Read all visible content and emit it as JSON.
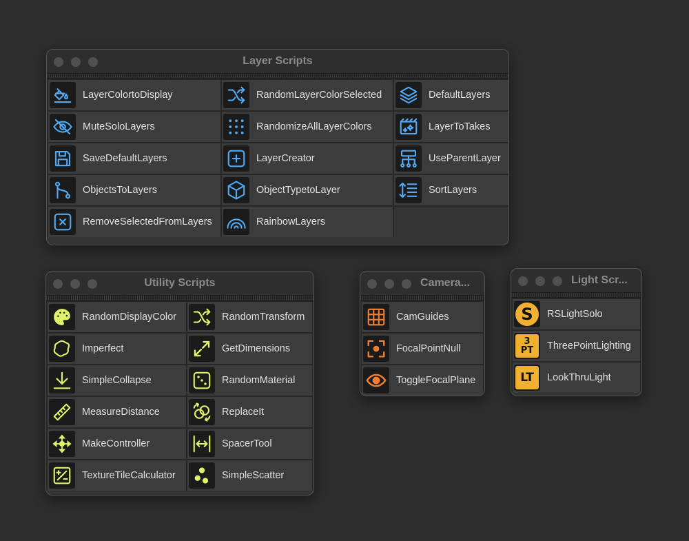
{
  "colors": {
    "background": "#2d2d2d",
    "layer_accent": "#52aaf5",
    "utility_accent": "#dff26a",
    "camera_accent": "#f08030",
    "light_accent": "#f0b030"
  },
  "layer_window": {
    "title": "Layer Scripts",
    "items": [
      {
        "label": "LayerColortoDisplay",
        "icon": "paint-bucket-icon"
      },
      {
        "label": "RandomLayerColorSelected",
        "icon": "shuffle-icon"
      },
      {
        "label": "DefaultLayers",
        "icon": "layers-stack-icon"
      },
      {
        "label": "MuteSoloLayers",
        "icon": "eye-off-icon"
      },
      {
        "label": "RandomizeAllLayerColors",
        "icon": "dot-grid-icon"
      },
      {
        "label": "LayerToTakes",
        "icon": "clapperboard-icon"
      },
      {
        "label": "SaveDefaultLayers",
        "icon": "floppy-disk-icon"
      },
      {
        "label": "LayerCreator",
        "icon": "plus-square-icon"
      },
      {
        "label": "UseParentLayer",
        "icon": "hierarchy-icon"
      },
      {
        "label": "ObjectsToLayers",
        "icon": "git-branch-icon"
      },
      {
        "label": "ObjectTypetoLayer",
        "icon": "cube-icon"
      },
      {
        "label": "SortLayers",
        "icon": "sort-lines-icon"
      },
      {
        "label": "RemoveSelectedFromLayers",
        "icon": "x-square-icon"
      },
      {
        "label": "RainbowLayers",
        "icon": "rainbow-icon"
      }
    ]
  },
  "utility_window": {
    "title": "Utility Scripts",
    "items": [
      {
        "label": "RandomDisplayColor",
        "icon": "palette-icon"
      },
      {
        "label": "RandomTransform",
        "icon": "shuffle-icon"
      },
      {
        "label": "Imperfect",
        "icon": "blob-icon"
      },
      {
        "label": "GetDimensions",
        "icon": "expand-arrows-icon"
      },
      {
        "label": "SimpleCollapse",
        "icon": "download-arrow-icon"
      },
      {
        "label": "RandomMaterial",
        "icon": "dice-icon"
      },
      {
        "label": "MeasureDistance",
        "icon": "ruler-icon"
      },
      {
        "label": "ReplaceIt",
        "icon": "replace-circles-icon"
      },
      {
        "label": "MakeController",
        "icon": "move-arrows-icon"
      },
      {
        "label": "SpacerTool",
        "icon": "spacer-icon"
      },
      {
        "label": "TextureTileCalculator",
        "icon": "calculator-icon"
      },
      {
        "label": "SimpleScatter",
        "icon": "scatter-dots-icon"
      }
    ]
  },
  "camera_window": {
    "title": "Camera...",
    "items": [
      {
        "label": "CamGuides",
        "icon": "grid-guides-icon"
      },
      {
        "label": "FocalPointNull",
        "icon": "focus-target-icon"
      },
      {
        "label": "ToggleFocalPlane",
        "icon": "eye-icon"
      }
    ]
  },
  "light_window": {
    "title": "Light Scr...",
    "items": [
      {
        "label": "RSLightSolo",
        "icon": "rs-solo-badge-icon",
        "badge": "S"
      },
      {
        "label": "ThreePointLighting",
        "icon": "three-point-badge-icon",
        "badge_top": "3",
        "badge_bottom": "PT"
      },
      {
        "label": "LookThruLight",
        "icon": "look-thru-badge-icon",
        "badge": "LT"
      }
    ]
  }
}
